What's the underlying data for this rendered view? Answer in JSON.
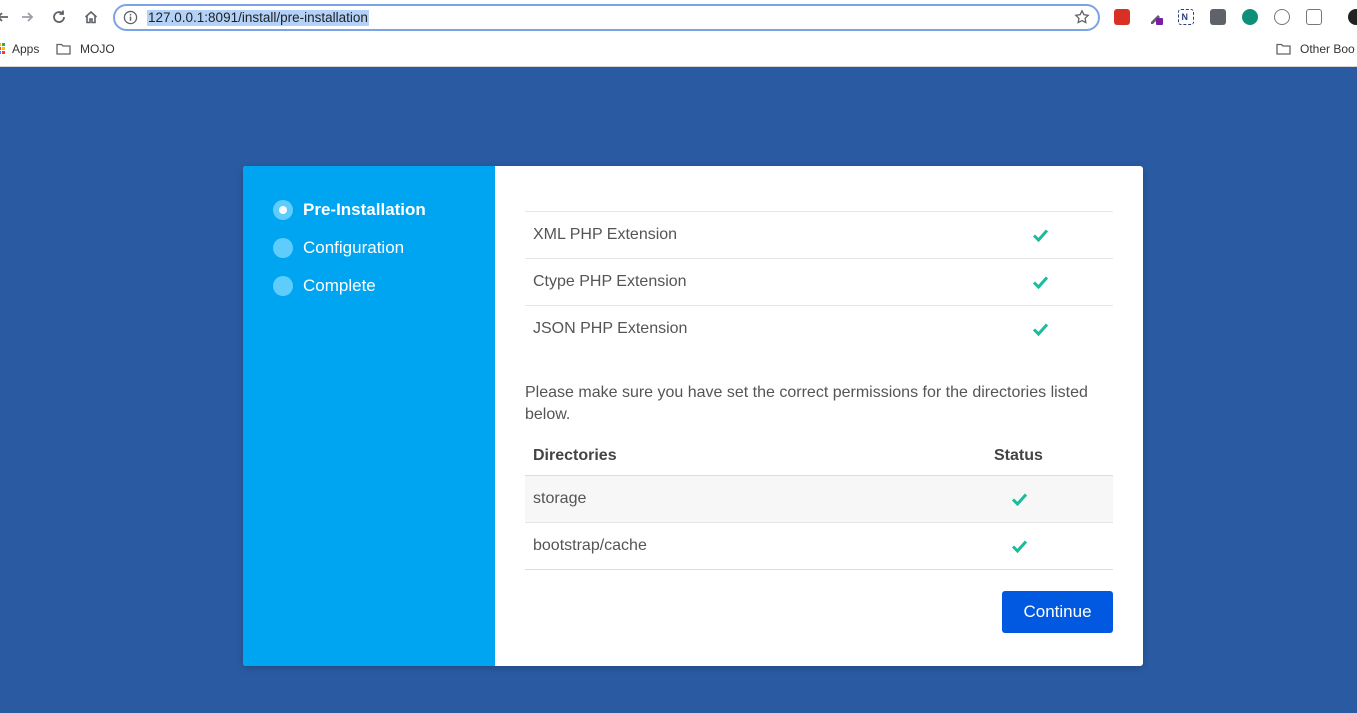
{
  "browser": {
    "url": "127.0.0.1:8091/install/pre-installation",
    "bookmarks": [
      {
        "label": "Apps"
      },
      {
        "label": "MOJO"
      },
      {
        "label": "Other Boo"
      }
    ]
  },
  "steps": [
    {
      "label": "Pre-Installation",
      "active": true
    },
    {
      "label": "Configuration",
      "active": false
    },
    {
      "label": "Complete",
      "active": false
    }
  ],
  "extensions": [
    {
      "name": "XML PHP Extension",
      "status": "check-icon"
    },
    {
      "name": "Ctype PHP Extension",
      "status": "check-icon"
    },
    {
      "name": "JSON PHP Extension",
      "status": "check-icon"
    }
  ],
  "permissions_note": "Please make sure you have set the correct permissions for the directories listed below.",
  "directories": {
    "header": {
      "name": "Directories",
      "status": "Status"
    },
    "rows": [
      {
        "name": "storage",
        "status": "check-icon"
      },
      {
        "name": "bootstrap/cache",
        "status": "check-icon"
      }
    ]
  },
  "continue_label": "Continue",
  "colors": {
    "page_bg": "#2a5ba2",
    "sidebar_bg": "#00a5f2",
    "check": "#1abc9c",
    "button": "#0159e1"
  }
}
